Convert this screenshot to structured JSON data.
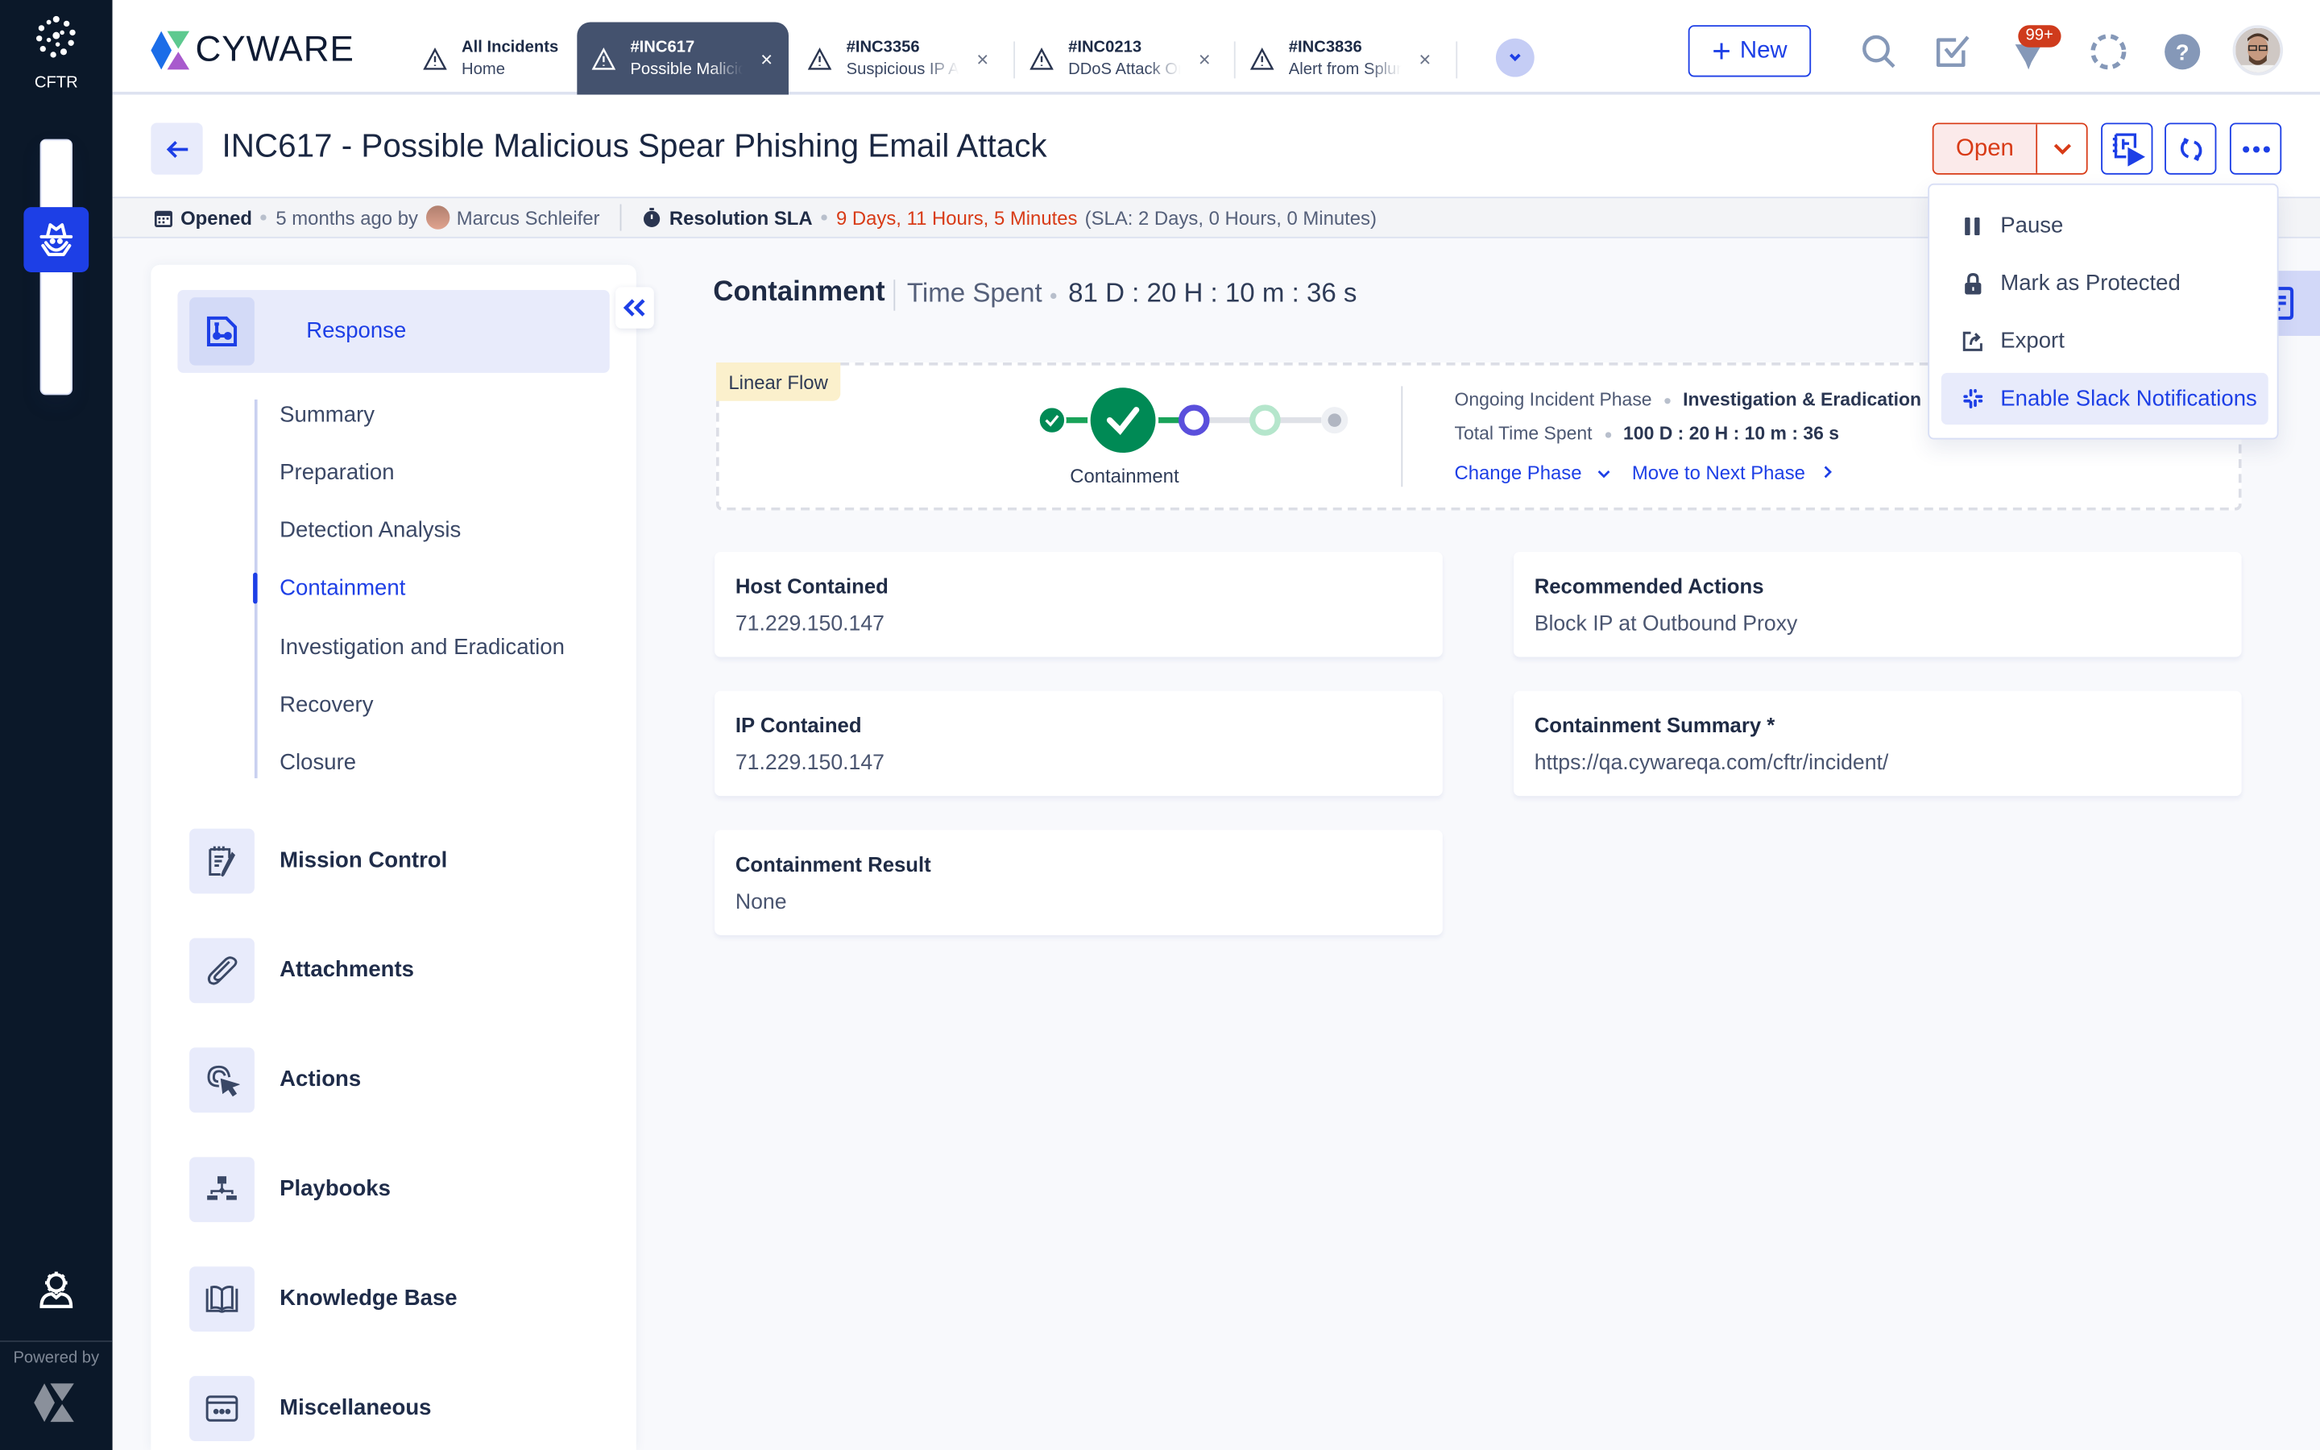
{
  "rail": {
    "app_label": "CFTR",
    "powered_by": "Powered by"
  },
  "topbar": {
    "brand": "CYWARE",
    "tabs": [
      {
        "title": "All Incidents",
        "subtitle": "Home",
        "active": false,
        "closable": false
      },
      {
        "title": "#INC617",
        "subtitle": "Possible Malicious Spear Phishing Email Attack",
        "active": true,
        "closable": true
      },
      {
        "title": "#INC3356",
        "subtitle": "Suspicious IP Address",
        "active": false,
        "closable": true
      },
      {
        "title": "#INC0213",
        "subtitle": "DDoS Attack On",
        "active": false,
        "closable": true
      },
      {
        "title": "#INC3836",
        "subtitle": "Alert from Splunk",
        "active": false,
        "closable": true
      }
    ],
    "close_glyph": "×",
    "new_label": "New",
    "notification_count": "99+"
  },
  "header": {
    "title": "INC617 - Possible Malicious Spear Phishing Email Attack",
    "status": "Open",
    "colors": {
      "status": "#d83b17",
      "accent": "#1d3fe6"
    }
  },
  "meta": {
    "opened_label": "Opened",
    "opened_when": "5 months ago by",
    "opened_by": "Marcus Schleifer",
    "sla_label": "Resolution SLA",
    "sla_elapsed": "9 Days, 11 Hours, 5 Minutes",
    "sla_target": "(SLA: 2 Days, 0 Hours, 0 Minutes)"
  },
  "sidenav": {
    "main": {
      "label": "Response"
    },
    "sub_items": [
      {
        "label": "Summary",
        "active": false
      },
      {
        "label": "Preparation",
        "active": false
      },
      {
        "label": "Detection Analysis",
        "active": false
      },
      {
        "label": "Containment",
        "active": true
      },
      {
        "label": "Investigation and Eradication",
        "active": false
      },
      {
        "label": "Recovery",
        "active": false
      },
      {
        "label": "Closure",
        "active": false
      }
    ],
    "sections": [
      {
        "label": "Mission Control",
        "icon": "notepad-edit-icon"
      },
      {
        "label": "Attachments",
        "icon": "paperclip-icon"
      },
      {
        "label": "Actions",
        "icon": "target-cursor-icon"
      },
      {
        "label": "Playbooks",
        "icon": "flowchart-icon"
      },
      {
        "label": "Knowledge Base",
        "icon": "book-open-icon"
      },
      {
        "label": "Miscellaneous",
        "icon": "window-dots-icon"
      }
    ]
  },
  "main": {
    "phase_title": "Containment",
    "time_spent_label": "Time Spent",
    "time_spent": "81 D : 20 H : 10 m : 36 s",
    "flow": {
      "tag": "Linear Flow",
      "current_step_label": "Containment",
      "steps": [
        {
          "state": "completed"
        },
        {
          "state": "current-completed"
        },
        {
          "state": "ongoing"
        },
        {
          "state": "pending"
        },
        {
          "state": "pending"
        }
      ],
      "ongoing_label": "Ongoing Incident Phase",
      "ongoing_value": "Investigation & Eradication",
      "total_label": "Total Time Spent",
      "total_value": "100 D : 20 H : 10 m : 36 s",
      "change_phase": "Change Phase",
      "next_phase": "Move to Next Phase"
    },
    "fields": [
      {
        "label": "Host Contained",
        "value": "71.229.150.147"
      },
      {
        "label": "Recommended Actions",
        "value": "Block IP at Outbound Proxy"
      },
      {
        "label": "IP Contained",
        "value": "71.229.150.147"
      },
      {
        "label": "Containment Summary *",
        "value": "https://qa.cywareqa.com/cftr/incident/"
      },
      {
        "label": "Containment Result",
        "value": "None"
      }
    ]
  },
  "more_menu": {
    "items": [
      {
        "label": "Pause",
        "icon": "pause-icon",
        "highlighted": false
      },
      {
        "label": "Mark as Protected",
        "icon": "lock-icon",
        "highlighted": false
      },
      {
        "label": "Export",
        "icon": "export-icon",
        "highlighted": false
      },
      {
        "label": "Enable Slack Notifications",
        "icon": "slack-icon",
        "highlighted": true
      }
    ]
  }
}
